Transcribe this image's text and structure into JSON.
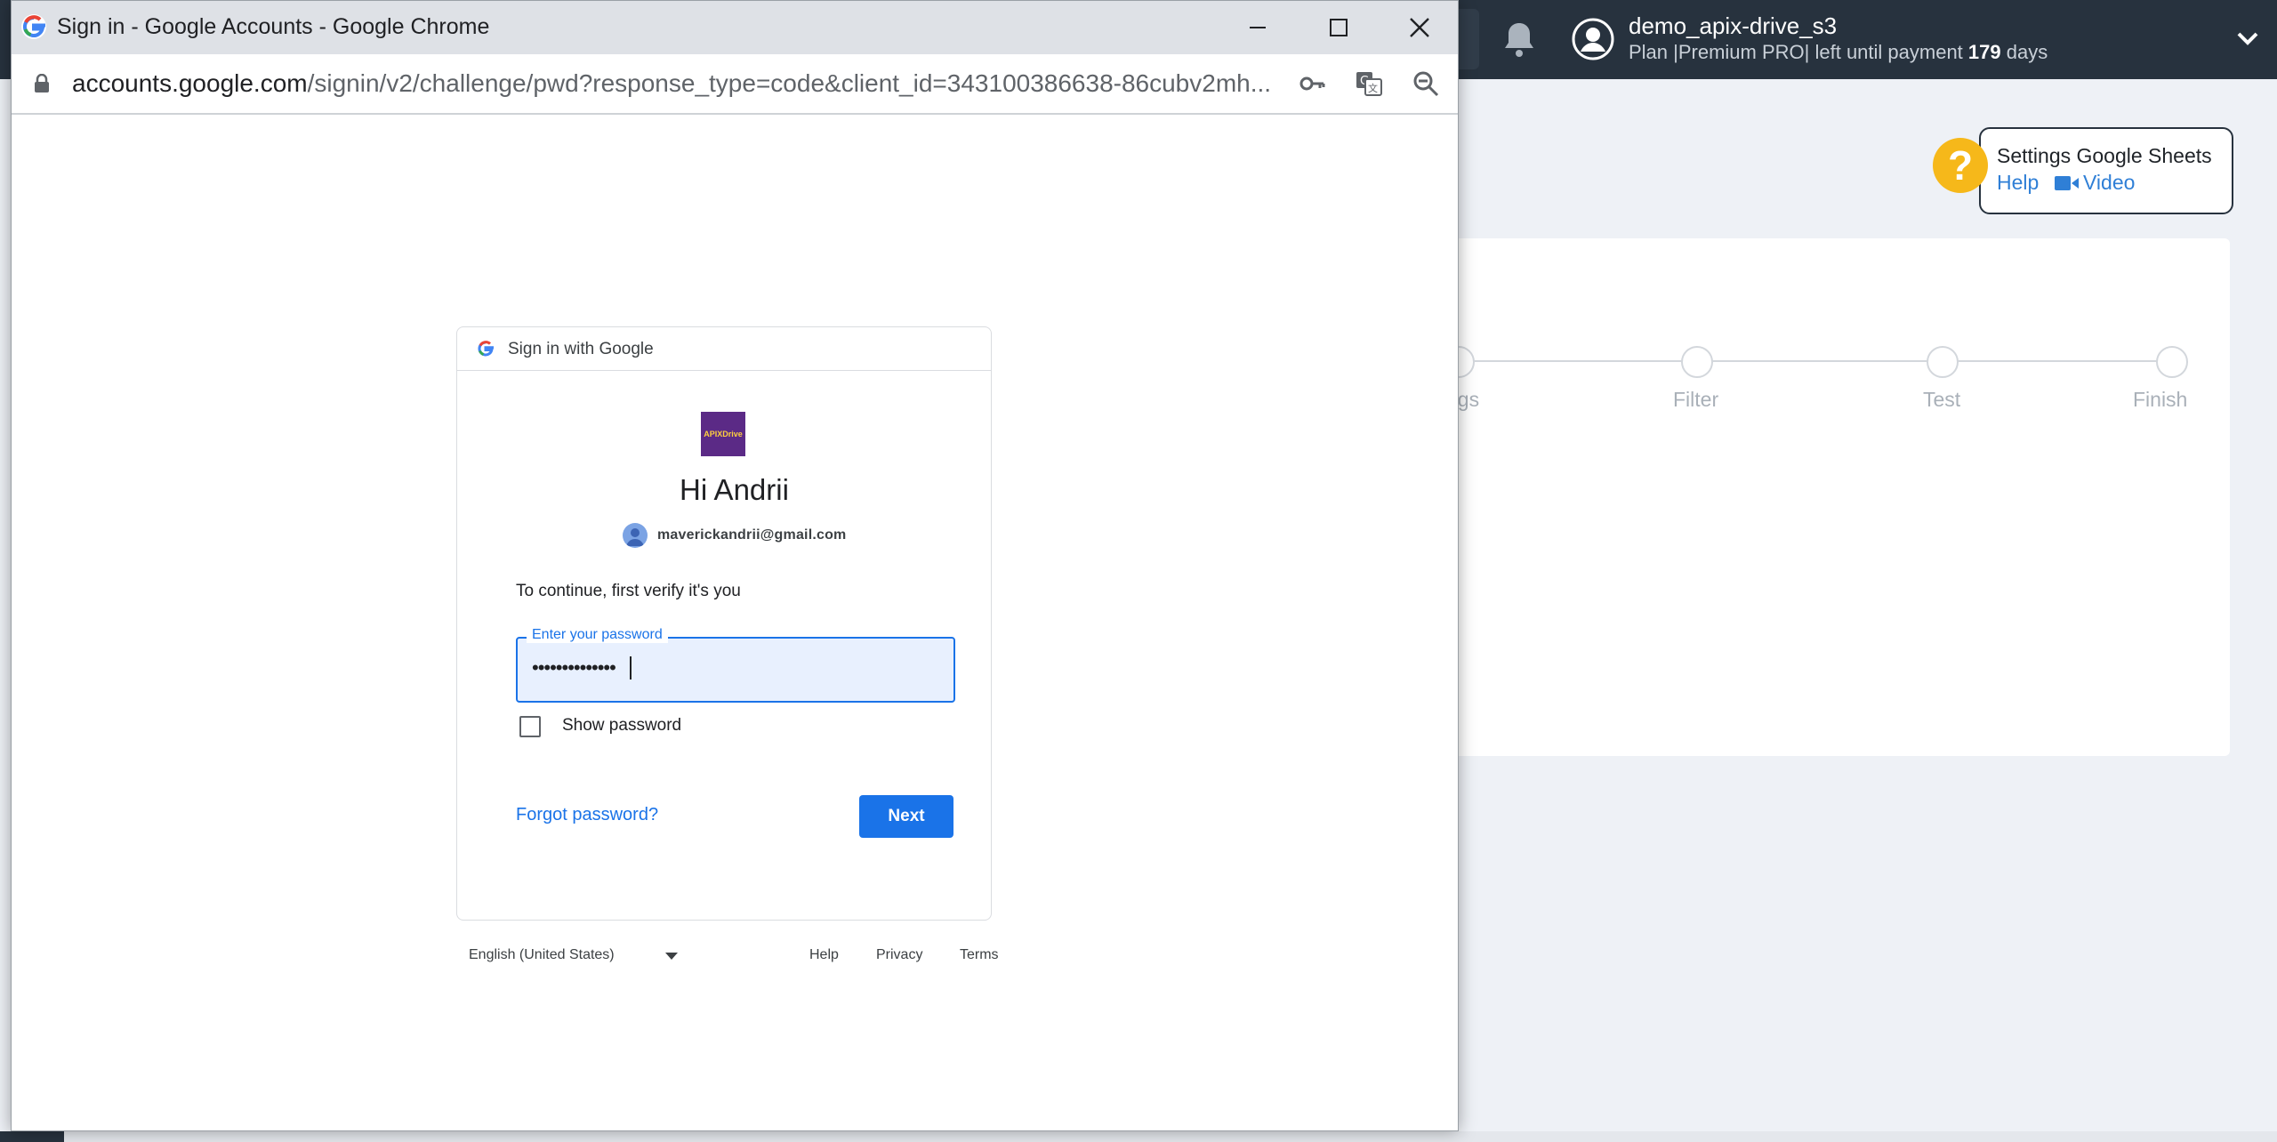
{
  "background_app": {
    "user": {
      "name": "demo_apix-drive_s3"
    },
    "plan": {
      "prefix": "Plan |Premium PRO| left until payment",
      "days": "179",
      "suffix": "days"
    },
    "help_box": {
      "title": "Settings Google Sheets",
      "help_label": "Help",
      "video_label": "Video",
      "icon_text": "?"
    },
    "steps": [
      {
        "label": "ngs"
      },
      {
        "label": "Filter"
      },
      {
        "label": "Test"
      },
      {
        "label": "Finish"
      }
    ],
    "colors": {
      "topbar": "#27323e",
      "accent_yellow": "#f6b81a",
      "link_blue": "#2f7fd6"
    }
  },
  "window": {
    "title": "Sign in - Google Accounts - Google Chrome",
    "url": {
      "domain": "accounts.google.com",
      "path": "/signin/v2/challenge/pwd?response_type=code&client_id=343100386638-86cubv2mh..."
    },
    "controls": [
      "minimize-icon",
      "maximize-icon",
      "close-icon"
    ],
    "address_icons": [
      "key-icon",
      "translate-icon",
      "zoom-out-icon"
    ]
  },
  "signin": {
    "header": "Sign in with Google",
    "logo_text": "APIXDrive",
    "greeting": "Hi Andrii",
    "email": "maverickandrii@gmail.com",
    "instruction": "To continue, first verify it's you",
    "password_label": "Enter your password",
    "password_value": "••••••••••••••",
    "show_password_label": "Show password",
    "forgot_label": "Forgot password?",
    "next_label": "Next",
    "colors": {
      "primary": "#1a73e8",
      "field_bg": "#e8f0fe"
    }
  },
  "footer": {
    "language": "English (United States)",
    "links": [
      "Help",
      "Privacy",
      "Terms"
    ]
  }
}
